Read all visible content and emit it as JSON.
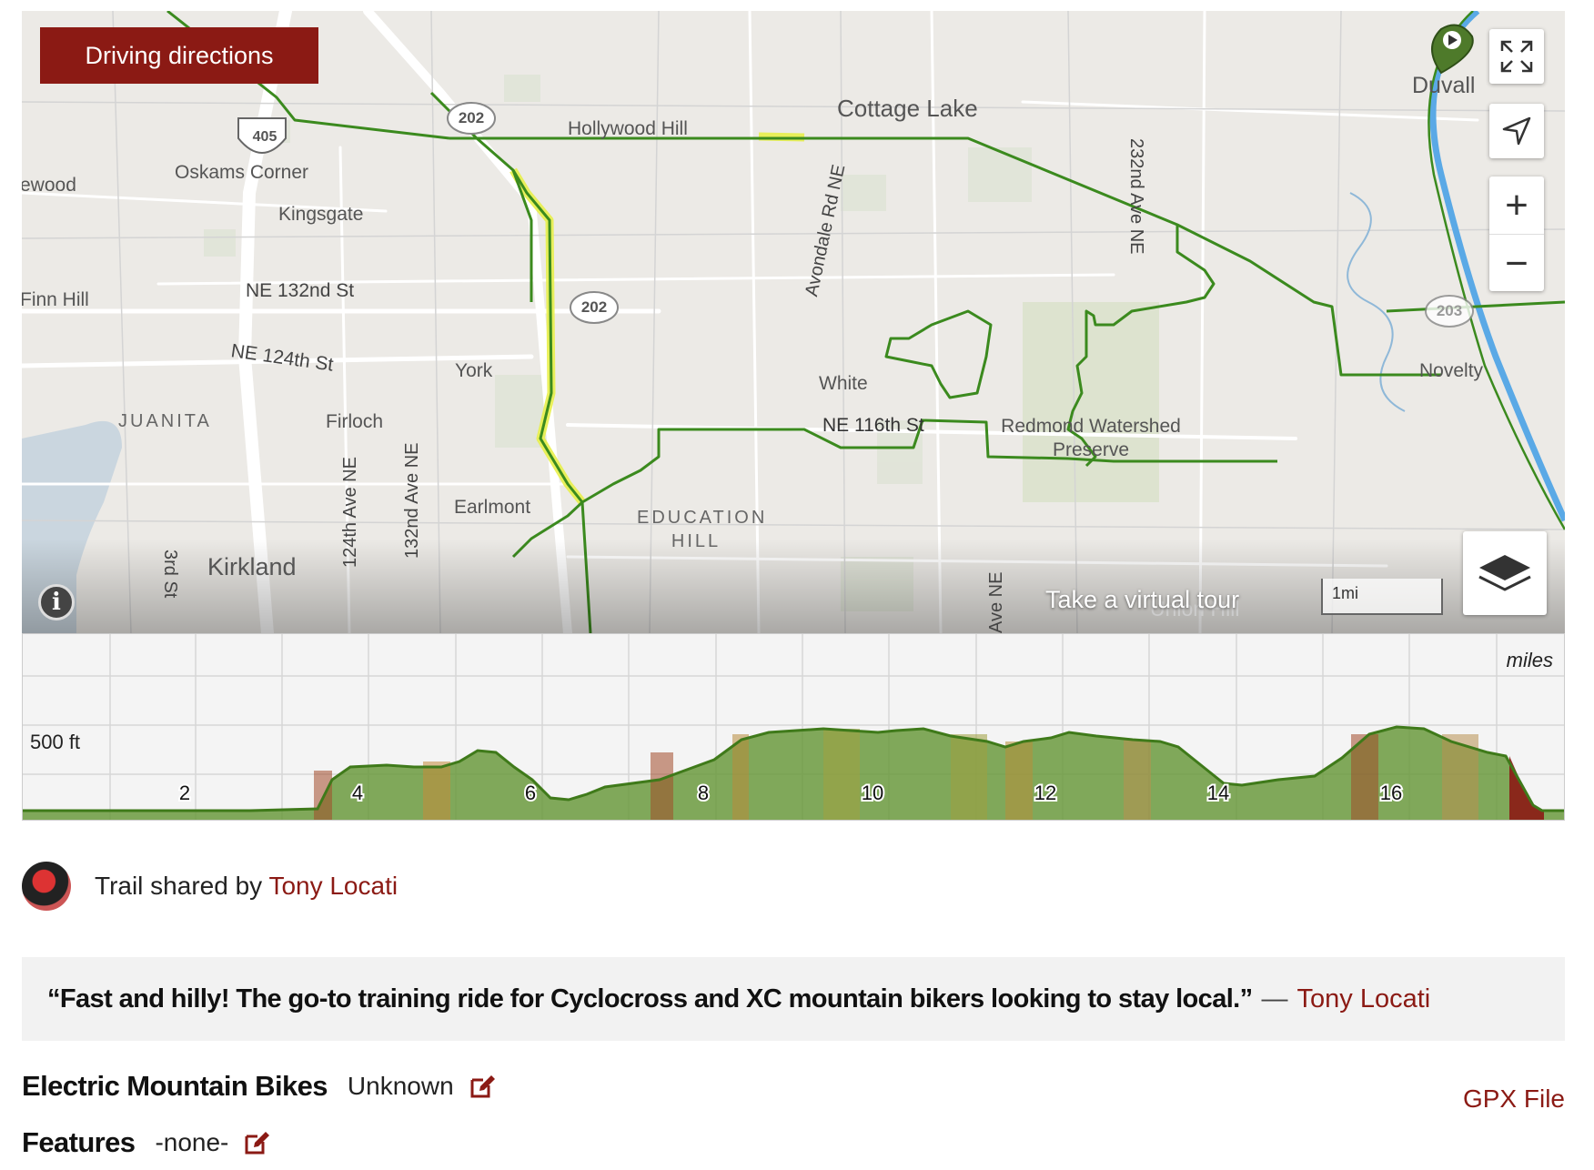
{
  "map": {
    "driving_button": "Driving directions",
    "virtual_tour": "Take a virtual tour",
    "scale": "1mi",
    "place_labels": {
      "cottage_lake": "Cottage Lake",
      "hollywood_hill": "Hollywood Hill",
      "oskams_corner": "Oskams Corner",
      "kingsgate": "Kingsgate",
      "ne_132nd": "NE 132nd St",
      "ne_124th": "NE 124th St",
      "york": "York",
      "juanita": "JUANITA",
      "firloch": "Firloch",
      "kirkland": "Kirkland",
      "earlmont": "Earlmont",
      "education_hill": "EDUCATION HILL",
      "white": "White",
      "ne_116th": "NE 116th St",
      "watershed": "Redmond Watershed Preserve",
      "duvall": "Duvall",
      "novelty": "Novelty",
      "union_hill": "Union Hill",
      "ewood": "ewood",
      "finn_hill": "Finn Hill",
      "avondale": "Avondale Rd NE",
      "ave_232": "232nd Ave NE",
      "ave_124": "124th Ave NE",
      "ave_132": "132nd Ave NE",
      "st_3rd": "3rd St",
      "ave_ne": "Ave NE",
      "shield_405": "405",
      "shield_202a": "202",
      "shield_202b": "202",
      "shield_203": "203"
    }
  },
  "elevation": {
    "unit": "miles",
    "y_label": "500 ft",
    "ticks": [
      "2",
      "4",
      "6",
      "8",
      "10",
      "12",
      "14",
      "16"
    ]
  },
  "author": {
    "prefix": "Trail shared by",
    "name": "Tony Locati"
  },
  "quote": {
    "text": "“Fast and hilly! The go-to training ride for Cyclocross and XC mountain bikers looking to stay local.”",
    "dash": "—",
    "author": "Tony Locati"
  },
  "details": {
    "ebikes_label": "Electric Mountain Bikes",
    "ebikes_value": "Unknown",
    "features_label": "Features",
    "features_value": "-none-",
    "gpx": "GPX File"
  },
  "colors": {
    "brand": "#8b1a14",
    "route": "#3b8a1e",
    "highlight": "#e8f04a",
    "river": "#5aa9e6"
  }
}
